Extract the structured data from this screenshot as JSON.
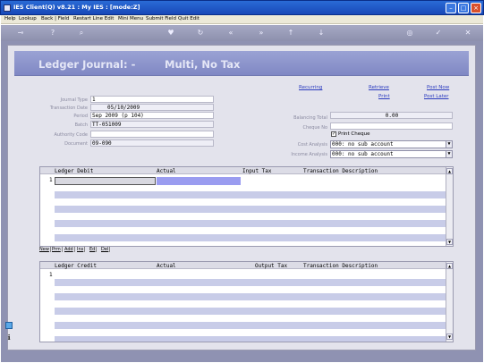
{
  "window": {
    "title": "IES Client(Q) v8.21 : My IES :      [mode:Z]"
  },
  "menu": [
    "Help",
    "Lookup",
    "Back | Field",
    "Restart Line Edit",
    "Mini Menu",
    "Submit Field",
    "Quit Edit"
  ],
  "toolbar_icons": [
    "key-icon",
    "help-icon",
    "search-icon",
    "heart-icon",
    "refresh-icon",
    "rewind-icon",
    "fast-forward-icon",
    "up-arrow-icon",
    "down-arrow-icon",
    "globe-icon",
    "check-icon",
    "close-icon"
  ],
  "banner": {
    "title": "Ledger Journal: -",
    "subtitle": "Multi, No Tax"
  },
  "links": {
    "recurring": "Recurring",
    "retrieve": "Retrieve",
    "post_now": "Post Now",
    "print": "Print",
    "post_later": "Post Later"
  },
  "form": {
    "journal_type": {
      "label": "Journal Type",
      "value": "1"
    },
    "transaction_date": {
      "label": "Transaction Date",
      "value": "05/10/2009"
    },
    "period": {
      "label": "Period",
      "value": "Sep 2009 (p 104)"
    },
    "batch": {
      "label": "Batch",
      "value": "TT-051009"
    },
    "authority_code": {
      "label": "Authority Code",
      "value": ""
    },
    "document": {
      "label": "Document",
      "value": "09-090"
    },
    "balancing_total": {
      "label": "Balancing Total",
      "value": "0.00"
    },
    "cheque_no": {
      "label": "Cheque No",
      "value": ""
    },
    "print_cheque": {
      "label": "Print Cheque",
      "checked": true
    },
    "cost_analysis": {
      "label": "Cost Analysis",
      "value": "000: no sub account"
    },
    "income_analysis": {
      "label": "Income Analysis",
      "value": "000: no sub account"
    }
  },
  "debit_grid": {
    "headers": [
      "Ledger Debit",
      "Actual",
      "Input Tax",
      "Transaction Description"
    ],
    "row_number": "1"
  },
  "grid_tabs": [
    "New",
    "Prm",
    "Add",
    "Ins",
    "Ed",
    "Del"
  ],
  "credit_grid": {
    "headers": [
      "Ledger Credit",
      "Actual",
      "Output Tax",
      "Transaction Description"
    ],
    "row_number": "1"
  }
}
